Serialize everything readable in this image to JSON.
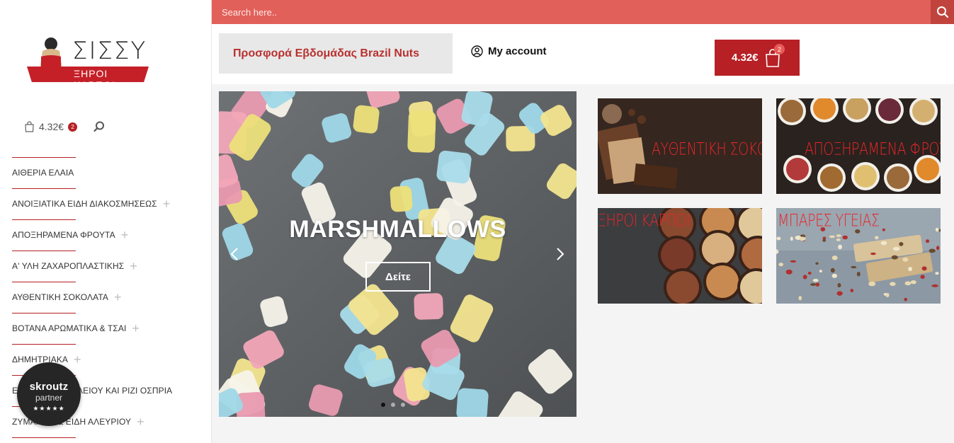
{
  "search": {
    "placeholder": "Search here.."
  },
  "brand": {
    "name": "ΣΙΣΣΥ",
    "subtitle": "ΞΗΡΟΙ ΚΑΡΠΟΙ"
  },
  "sidebar": {
    "cart_price": "4.32€",
    "cart_count": "2",
    "categories": [
      {
        "label": "ΑΙΘΕΡΙΑ ΕΛΑΙΑ",
        "expandable": false
      },
      {
        "label": "ΑΝΟΙΞΙΑΤΙΚΑ ΕΙΔΗ ΔΙΑΚΟΣΜΗΣΕΩΣ",
        "expandable": true
      },
      {
        "label": "ΑΠΟΞΗΡΑΜΕΝΑ ΦΡΟΥΤΑ",
        "expandable": true
      },
      {
        "label": "Α' ΥΛΗ ΖΑΧΑΡΟΠΛΑΣΤΙΚΗΣ",
        "expandable": true
      },
      {
        "label": "ΑΥΘΕΝΤΙΚΗ ΣΟΚΟΛΑΤΑ",
        "expandable": true
      },
      {
        "label": "ΒΟΤΑΝΑ ΑΡΩΜΑΤΙΚΑ & ΤΣΑΙ",
        "expandable": true
      },
      {
        "label": "ΔΗΜΗΤΡΙΑΚΑ",
        "expandable": true
      },
      {
        "label": "ΕΙΔΗ ΠΑΝΤΟΠΩΛΕΙΟΥ ΚΑΙ ΡΙΖΙ ΟΣΠΡΙΑ",
        "expandable": false
      },
      {
        "label": "ΖΥΜΑΡΙΚΑ & ΕΙΔΗ ΑΛΕΥΡΙΟΥ",
        "expandable": true
      }
    ]
  },
  "badge": {
    "brand": "skroutz",
    "tier": "partner",
    "stars": "★★★★★"
  },
  "header": {
    "offer": "Προσφορά Εβδομάδας Brazil Nuts",
    "account": "My account",
    "cart_price": "4.32€",
    "cart_count": "2"
  },
  "slider": {
    "title": "MARSHMALLOWS",
    "button": "Δείτε",
    "slide_count": 3,
    "active_slide": 1
  },
  "tiles": [
    {
      "label": "ΑΥΘΕΝΤΙΚΗ ΣΟΚΟΛΑΤΑ"
    },
    {
      "label": "ΑΠΟΞΗΡΑΜΕΝΑ ΦΡΟΥΤΑ"
    },
    {
      "label": "ΞΗΡΟΙ ΚΑΡΠΟΙ"
    },
    {
      "label": "ΜΠΑΡΕΣ ΥΓΕΙΑΣ"
    }
  ],
  "colors": {
    "accent": "#b72025",
    "search_bar": "#e2605a",
    "offer_text": "#b8312f"
  }
}
